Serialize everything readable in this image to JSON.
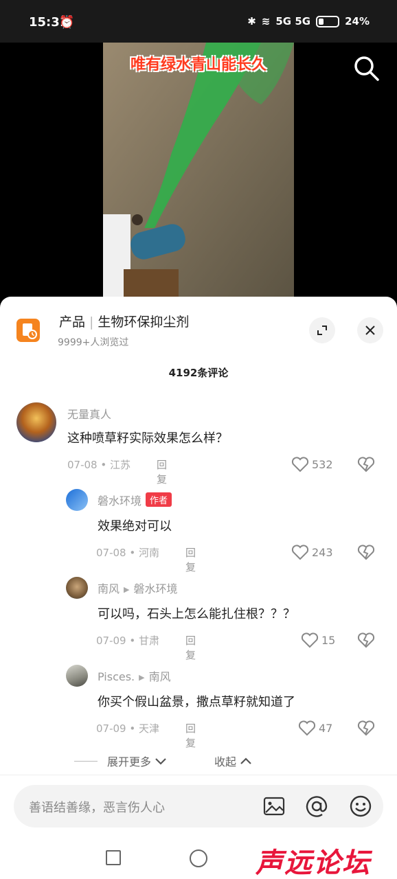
{
  "status": {
    "time": "15:31",
    "network": "5G 5G",
    "battery": "24%"
  },
  "video": {
    "caption": "唯有绿水青山能长久"
  },
  "product": {
    "category": "产品",
    "name": "生物环保抑尘剂",
    "views": "9999+人浏览过"
  },
  "comments_header": {
    "count": "4192条评论"
  },
  "comments": [
    {
      "name": "无量真人",
      "text": "这种喷草籽实际效果怎么样？",
      "date": "07-08",
      "location": "江苏",
      "reply": "回复",
      "likes": "532"
    },
    {
      "name": "磐水环境",
      "tag": "作者",
      "text": "效果绝对可以",
      "date": "07-08",
      "location": "河南",
      "reply": "回复",
      "likes": "243"
    },
    {
      "name": "南风",
      "reply_to": "磐水环境",
      "text": "可以吗，石头上怎么能扎住根？？？",
      "date": "07-09",
      "location": "甘肃",
      "reply": "回复",
      "likes": "15"
    },
    {
      "name": "Pisces.",
      "reply_to": "南风",
      "text": "你买个假山盆景，撒点草籽就知道了",
      "date": "07-09",
      "location": "天津",
      "reply": "回复",
      "likes": "47"
    }
  ],
  "thread": {
    "expand": "展开更多",
    "collapse": "收起"
  },
  "input": {
    "placeholder": "善语结善缘，恶言伤人心"
  },
  "watermark": "声远论坛",
  "colors": {
    "accent": "#f03c47",
    "product_icon": "#f5841f"
  }
}
